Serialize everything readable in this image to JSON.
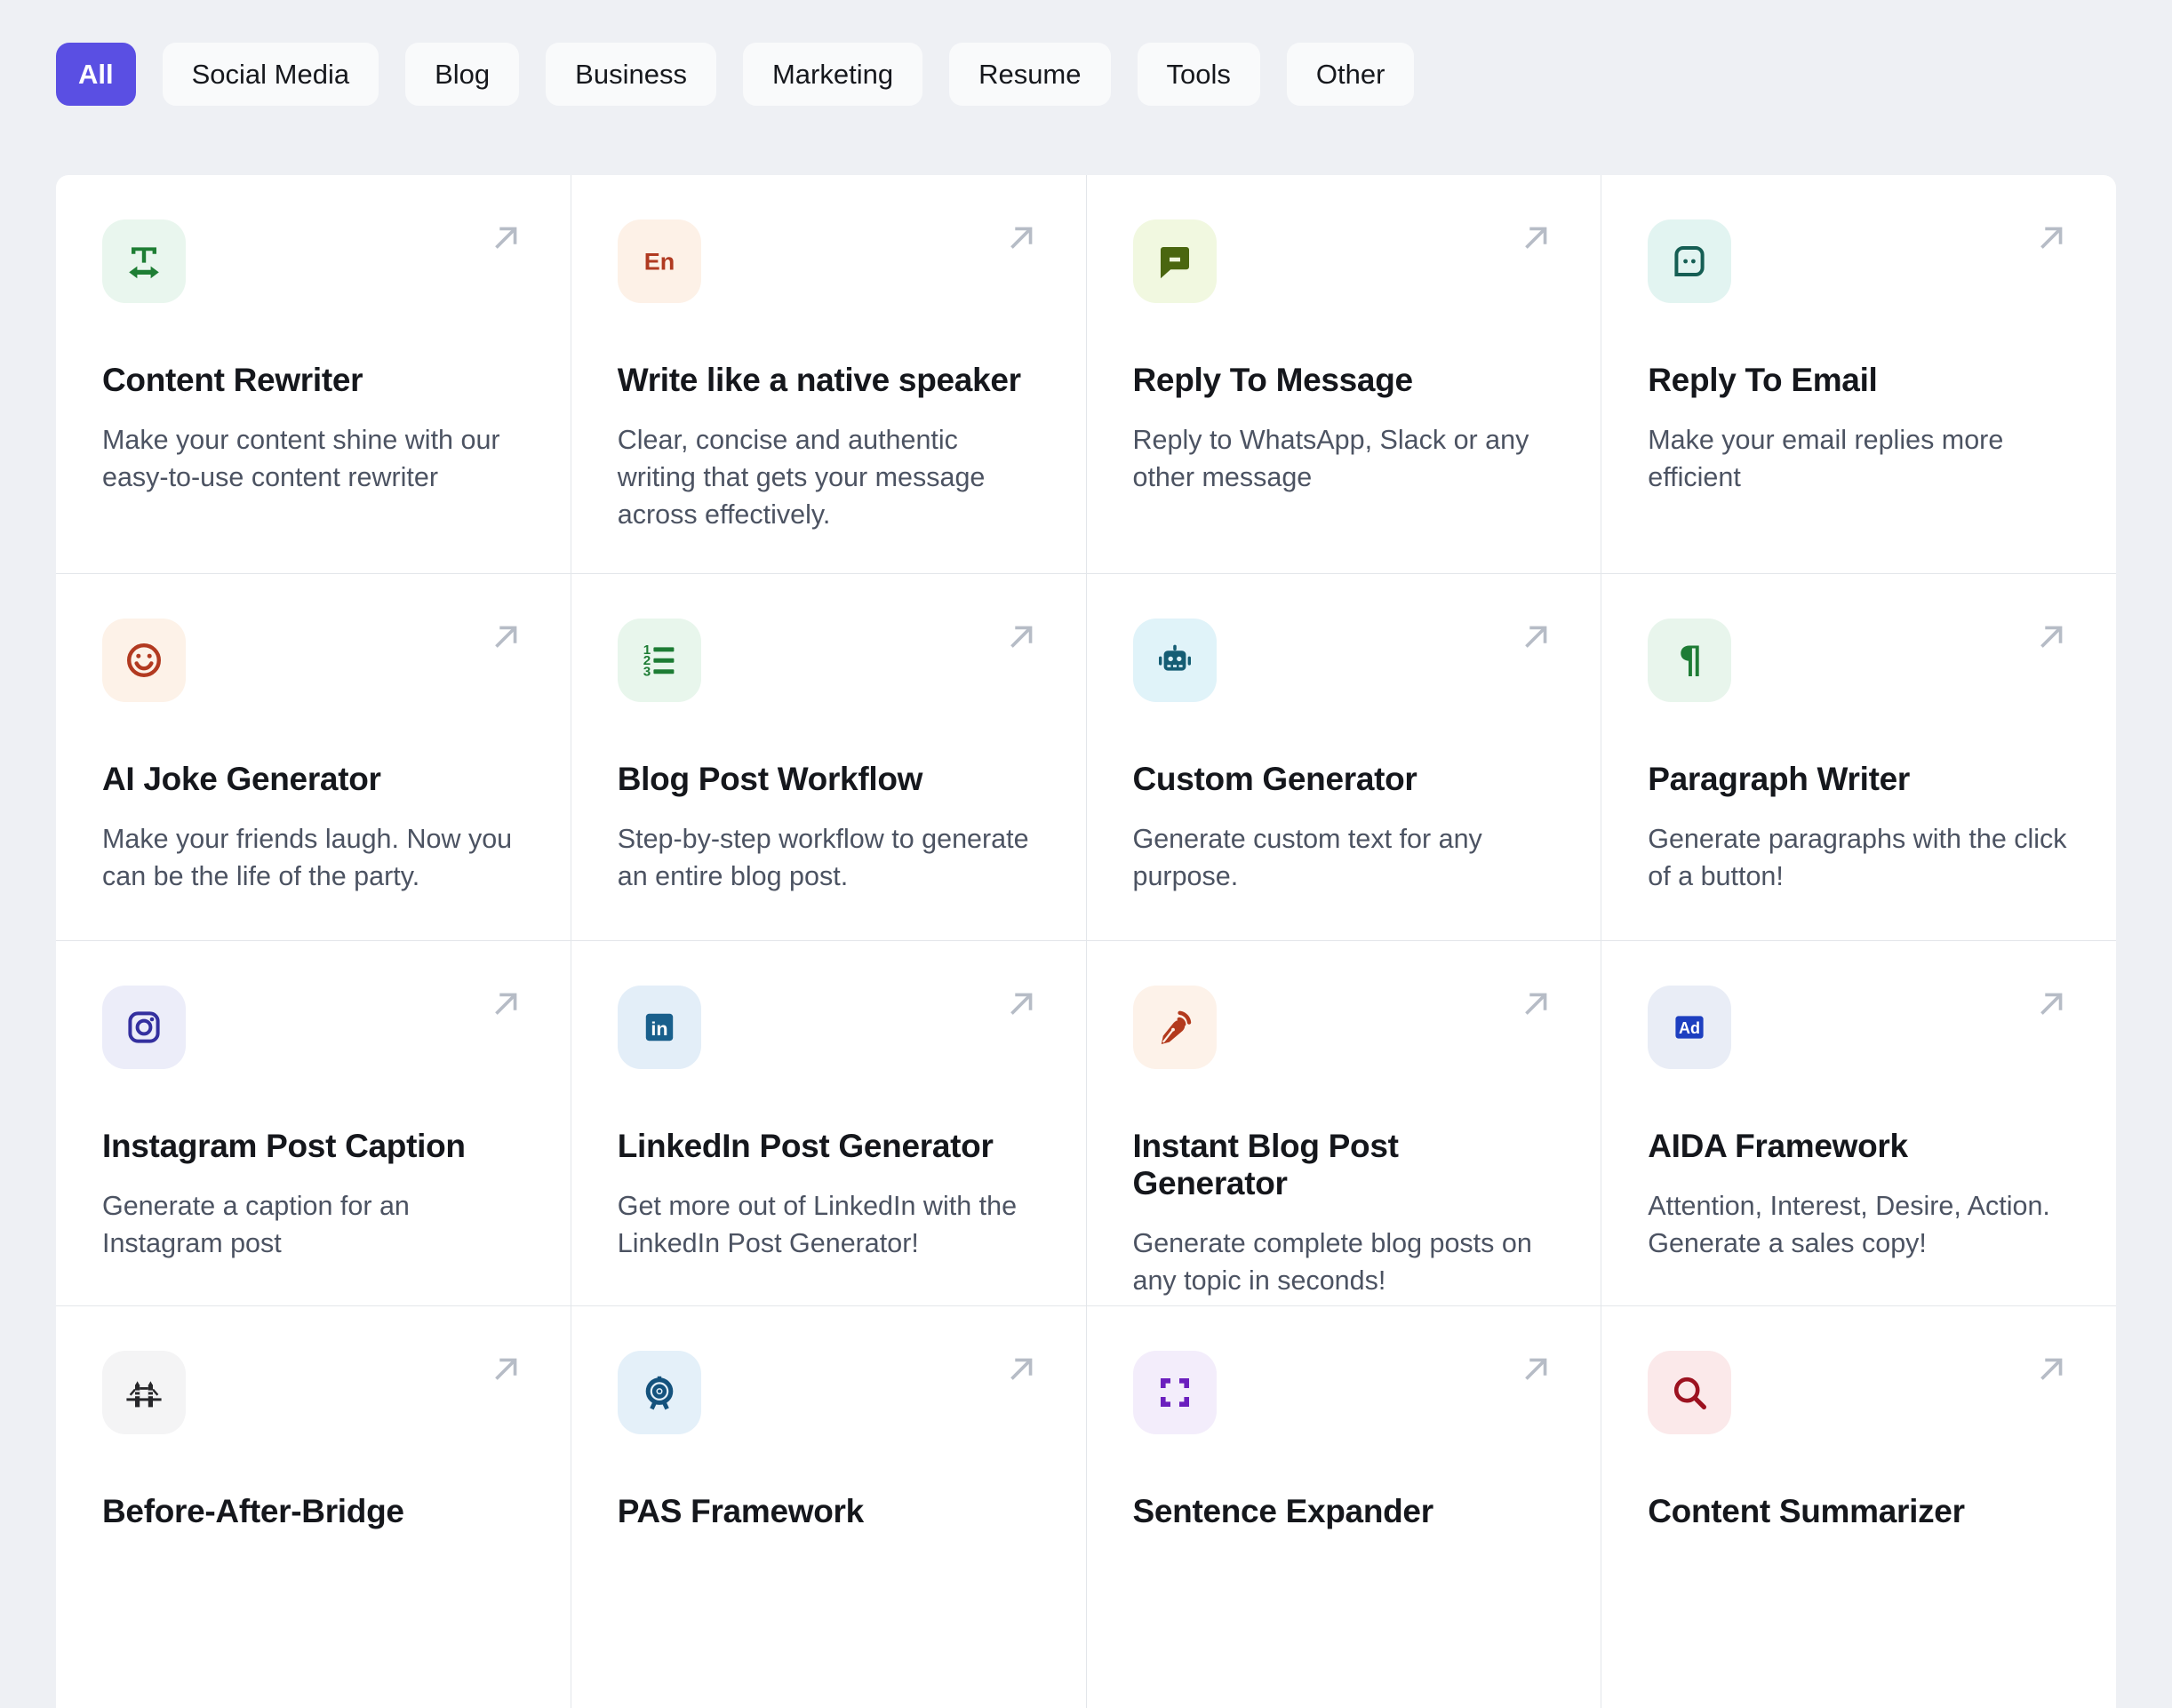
{
  "accent_color": "#5a4fe3",
  "tabs": [
    {
      "label": "All",
      "active": true
    },
    {
      "label": "Social Media",
      "active": false
    },
    {
      "label": "Blog",
      "active": false
    },
    {
      "label": "Business",
      "active": false
    },
    {
      "label": "Marketing",
      "active": false
    },
    {
      "label": "Resume",
      "active": false
    },
    {
      "label": "Tools",
      "active": false
    },
    {
      "label": "Other",
      "active": false
    }
  ],
  "card_arrow": {
    "icon": "arrow-up-right-icon",
    "color": "#b6bcc6"
  },
  "cards": [
    {
      "title": "Content Rewriter",
      "description": "Make your content shine with our easy-to-use content rewriter",
      "icon": "text-width-icon",
      "tile_bg": "#e9f6ee",
      "icon_color": "#1e7e34"
    },
    {
      "title": "Write like a native speaker",
      "description": "Clear, concise and authentic writing that gets your message across effectively.",
      "icon": "en-language-icon",
      "tile_bg": "#fdf1e7",
      "icon_color": "#b03a21"
    },
    {
      "title": "Reply To Message",
      "description": "Reply to WhatsApp, Slack or any other message",
      "icon": "chat-bubble-minus-icon",
      "tile_bg": "#f1f8e0",
      "icon_color": "#4a660f"
    },
    {
      "title": "Reply To Email",
      "description": "Make your email replies more efficient",
      "icon": "chat-bubble-dots-icon",
      "tile_bg": "#e2f4f1",
      "icon_color": "#155e54"
    },
    {
      "title": "AI Joke Generator",
      "description": "Make your friends laugh. Now you can be the life of the party.",
      "icon": "smiley-face-icon",
      "tile_bg": "#fdf2e8",
      "icon_color": "#b23a20"
    },
    {
      "title": "Blog Post Workflow",
      "description": "Step-by-step workflow to generate an entire blog post.",
      "icon": "numbered-list-icon",
      "tile_bg": "#e8f6ec",
      "icon_color": "#1d7c34"
    },
    {
      "title": "Custom Generator",
      "description": "Generate custom text for any purpose.",
      "icon": "robot-icon",
      "tile_bg": "#e0f3f9",
      "icon_color": "#155d74"
    },
    {
      "title": "Paragraph Writer",
      "description": "Generate paragraphs with the click of a button!",
      "icon": "pilcrow-icon",
      "tile_bg": "#e8f5ec",
      "icon_color": "#1e7c35"
    },
    {
      "title": "Instagram Post Caption",
      "description": "Generate a caption for an Instagram post",
      "icon": "instagram-icon",
      "tile_bg": "#ecedf9",
      "icon_color": "#34309f"
    },
    {
      "title": "LinkedIn Post Generator",
      "description": "Get more out of LinkedIn with the LinkedIn Post Generator!",
      "icon": "linkedin-icon",
      "tile_bg": "#e3eef8",
      "icon_color": "#195f8c"
    },
    {
      "title": "Instant Blog Post Generator",
      "description": "Generate complete blog posts on any topic in seconds!",
      "icon": "pen-nib-rss-icon",
      "tile_bg": "#fdf2e9",
      "icon_color": "#b33a1d"
    },
    {
      "title": "AIDA Framework",
      "description": "Attention, Interest, Desire, Action. Generate a sales copy!",
      "icon": "ad-badge-icon",
      "tile_bg": "#e9edf6",
      "icon_color": "#1d3fc0"
    },
    {
      "title": "Before-After-Bridge",
      "description": "",
      "icon": "bridge-icon",
      "tile_bg": "#f4f4f5",
      "icon_color": "#27272a"
    },
    {
      "title": "PAS Framework",
      "description": "",
      "icon": "target-stand-icon",
      "tile_bg": "#e4f0f9",
      "icon_color": "#14527d"
    },
    {
      "title": "Sentence Expander",
      "description": "",
      "icon": "expand-icon",
      "tile_bg": "#f3edfb",
      "icon_color": "#6b1fbe"
    },
    {
      "title": "Content Summarizer",
      "description": "",
      "icon": "magnifier-icon",
      "tile_bg": "#fbe9ea",
      "icon_color": "#9c1220"
    }
  ]
}
